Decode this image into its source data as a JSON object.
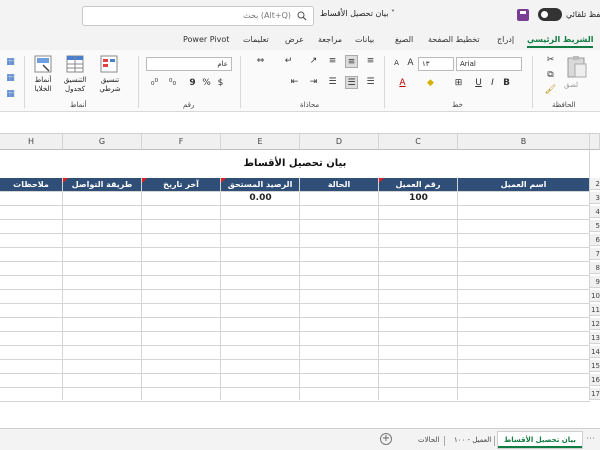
{
  "titlebar": {
    "search_placeholder": "بحث (Alt+Q)",
    "document_title": "بيان تحصيل الأقساط ˅",
    "autosave_label": "حفظ تلقائي"
  },
  "ribbon_tabs": [
    "الشريط الرئيسي",
    "إدراج",
    "تخطيط الصفحة",
    "الصيغ",
    "بيانات",
    "مراجعة",
    "عرض",
    "تعليمات",
    "Power Pivot"
  ],
  "ribbon": {
    "paste_label": "لصق",
    "clipboard_label": "الحافظة",
    "font_name": "Arial",
    "font_size": "١٣",
    "font_group_label": "خط",
    "alignment_label": "محاذاة",
    "number_format": "عام",
    "number_label": "رقم",
    "conditional_label": "تنسيق شرطي",
    "table_format_label": "التنسيق كجدول",
    "cell_styles_label": "أنماط الخلايا",
    "styles_label": "أنماط"
  },
  "columns": [
    "B",
    "C",
    "D",
    "E",
    "F",
    "G",
    "H"
  ],
  "sheet": {
    "title": "بيان تحصيل الأقساط",
    "headers": [
      "اسم العميل",
      "رقم العميل",
      "الحالة",
      "الرصيد المستحق",
      "آخر تاريخ",
      "طريقة التواصل",
      "ملاحظات"
    ],
    "client_number": "100",
    "balance_due": "0.00"
  },
  "row_numbers": [
    "2",
    "3",
    "4",
    "5",
    "6",
    "7",
    "8",
    "9",
    "10",
    "11",
    "12",
    "13",
    "14",
    "15",
    "16",
    "17"
  ],
  "sheet_tabs": [
    "بيان تحصيل الأقساط",
    "العميل - ١٠٠",
    "الحالات"
  ],
  "colors": {
    "accent": "#107c41",
    "header_fill": "#2f4f79",
    "note_marker": "#e02020"
  }
}
